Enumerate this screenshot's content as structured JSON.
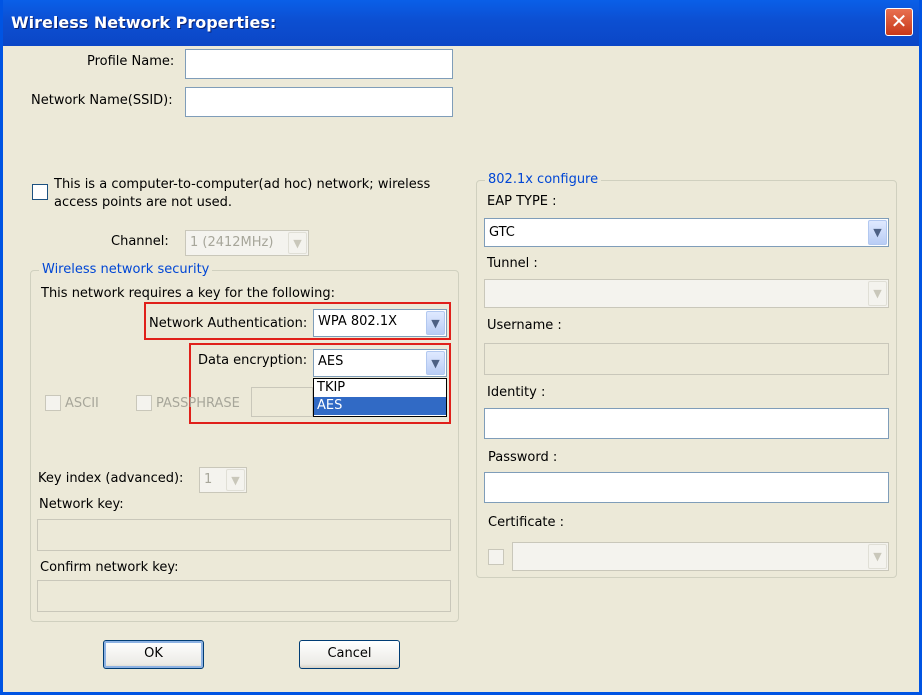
{
  "window": {
    "title": "Wireless Network Properties:",
    "close_glyph": "✕"
  },
  "profile": {
    "label": "Profile Name:",
    "value": ""
  },
  "ssid": {
    "label": "Network Name(SSID):",
    "value": ""
  },
  "adhoc": {
    "line1": "This is a computer-to-computer(ad hoc) network; wireless",
    "line2": "access points are not used.",
    "checked": false
  },
  "channel": {
    "label": "Channel:",
    "value": "1  (2412MHz)"
  },
  "security": {
    "caption": "Wireless network security",
    "requires_text": "This network requires a key for the following:",
    "auth_label": "Network Authentication:",
    "auth_value": "WPA 802.1X",
    "enc_label": "Data encryption:",
    "enc_value": "AES",
    "enc_options": [
      "TKIP",
      "AES"
    ],
    "enc_selected_index": 1,
    "ascii_label": "ASCII",
    "passphrase_label": "PASSPHRASE",
    "key_index_label": "Key index (advanced):",
    "key_index_value": "1",
    "network_key_label": "Network key:",
    "confirm_key_label": "Confirm network key:"
  },
  "dot1x": {
    "caption": "802.1x configure",
    "eap_label": "EAP TYPE :",
    "eap_value": "GTC",
    "tunnel_label": "Tunnel :",
    "username_label": "Username :",
    "identity_label": "Identity :",
    "password_label": "Password :",
    "certificate_label": "Certificate :"
  },
  "buttons": {
    "ok": "OK",
    "cancel": "Cancel"
  },
  "icons": {
    "dropdown": "chevron-down-icon",
    "close": "close-icon"
  },
  "colors": {
    "title_bar": "#0b4fd2",
    "dialog_bg": "#ece9d8",
    "highlight_box": "#e0201a",
    "selection": "#316ac5"
  }
}
